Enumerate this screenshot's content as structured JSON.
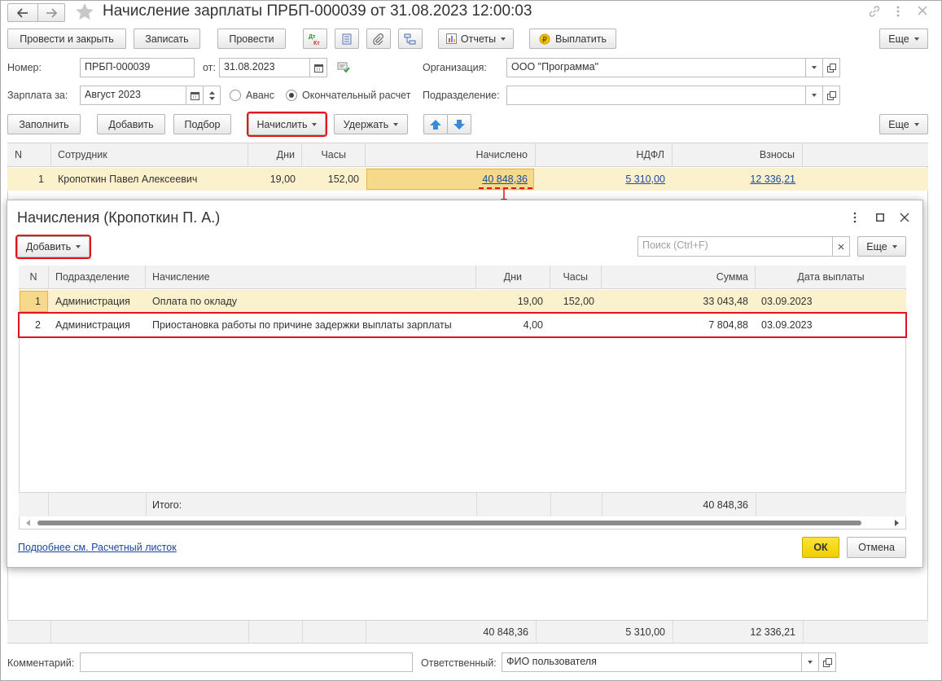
{
  "window": {
    "title": "Начисление зарплаты ПРБП-000039 от 31.08.2023 12:00:03"
  },
  "toolbar": {
    "post_close": "Провести и закрыть",
    "save": "Записать",
    "post": "Провести",
    "reports": "Отчеты",
    "pay": "Выплатить",
    "more": "Еще"
  },
  "form": {
    "number_label": "Номер:",
    "number_value": "ПРБП-000039",
    "date_label": "от:",
    "date_value": "31.08.2023",
    "org_label": "Организация:",
    "org_value": "ООО \"Программа\"",
    "period_label": "Зарплата за:",
    "period_value": "Август 2023",
    "advance_label": "Аванс",
    "final_label": "Окончательный расчет",
    "dept_label": "Подразделение:",
    "dept_value": ""
  },
  "actions": {
    "fill": "Заполнить",
    "add": "Добавить",
    "select": "Подбор",
    "accrue": "Начислить",
    "withhold": "Удержать",
    "more": "Еще"
  },
  "main_table": {
    "headers": [
      "N",
      "Сотрудник",
      "Дни",
      "Часы",
      "Начислено",
      "НДФЛ",
      "Взносы"
    ],
    "rows": [
      [
        "1",
        "Кропоткин Павел Алексеевич",
        "19,00",
        "152,00",
        "40 848,36",
        "5 310,00",
        "12 336,21"
      ]
    ],
    "totals": {
      "accrued": "40 848,36",
      "ndfl": "5 310,00",
      "contrib": "12 336,21"
    }
  },
  "dialog": {
    "title": "Начисления (Кропоткин П. А.)",
    "add": "Добавить",
    "search_placeholder": "Поиск (Ctrl+F)",
    "more": "Еще",
    "headers": [
      "N",
      "Подразделение",
      "Начисление",
      "Дни",
      "Часы",
      "Сумма",
      "Дата выплаты"
    ],
    "rows": [
      [
        "1",
        "Администрация",
        "Оплата по окладу",
        "19,00",
        "152,00",
        "33 043,48",
        "03.09.2023"
      ],
      [
        "2",
        "Администрация",
        "Приостановка работы по причине задержки выплаты зарплаты",
        "4,00",
        "",
        "7 804,88",
        "03.09.2023"
      ]
    ],
    "total_label": "Итого:",
    "total_value": "40 848,36",
    "link": "Подробнее см. Расчетный листок",
    "ok": "ОК",
    "cancel": "Отмена"
  },
  "bottom": {
    "comment_label": "Комментарий:",
    "comment_value": "",
    "responsible_label": "Ответственный:",
    "responsible_value": "ФИО пользователя"
  },
  "colors": {
    "highlight": "#e0141c",
    "selected_row": "#fbf1cc",
    "ok_button": "#f5d90a",
    "link": "#1b49a3"
  }
}
